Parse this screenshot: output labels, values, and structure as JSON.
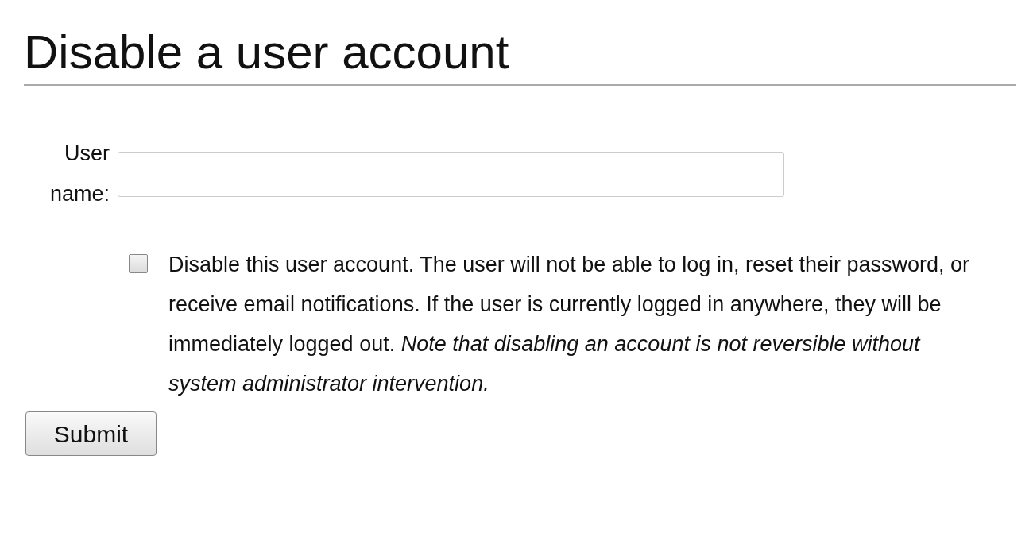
{
  "heading": "Disable a user account",
  "form": {
    "username_label": "User name:",
    "checkbox": {
      "checked": false,
      "text": "Disable this user account. The user will not be able to log in, reset their password, or receive email notifications. If the user is currently logged in anywhere, they will be immediately logged out. *Note that disabling an account is not reversible without system administrator intervention.*"
    },
    "submit": "Submit"
  }
}
